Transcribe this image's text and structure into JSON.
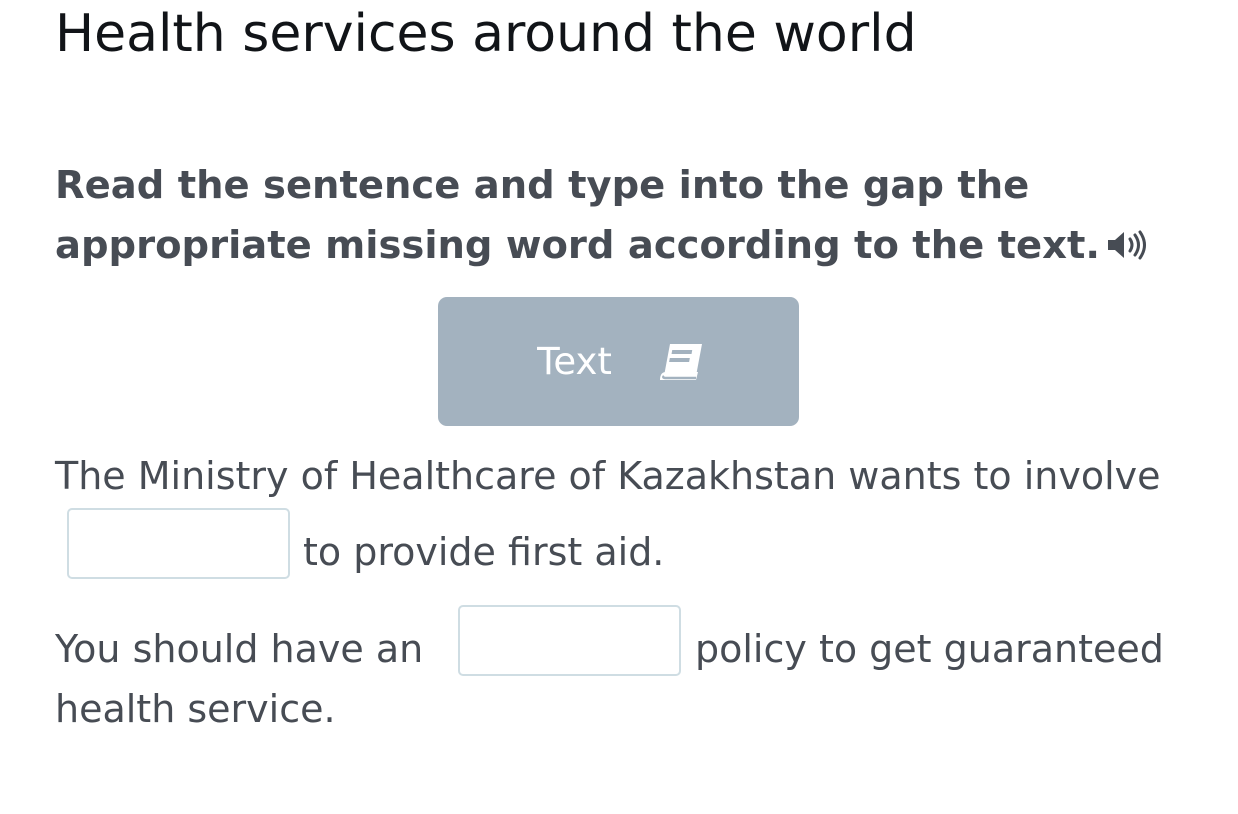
{
  "page": {
    "title": "Health services around the world"
  },
  "instruction": {
    "line1": "Read the sentence and type into the gap the",
    "line2": "appropriate missing word according to the text.",
    "audio_icon": "speaker-icon"
  },
  "text_button": {
    "label": "Text",
    "icon": "book-icon"
  },
  "sentences": [
    {
      "before": "The Ministry of Healthcare of Kazakhstan wants to involve",
      "gap_value": "",
      "after": "to provide first aid."
    },
    {
      "before": "You should have an",
      "gap_value": "",
      "after_line1": "policy to get guaranteed",
      "after_line2": "health service."
    }
  ],
  "colors": {
    "title_text": "#111418",
    "body_text": "#474c54",
    "button_bg": "#a3b2bf",
    "input_border": "#cfdde3"
  }
}
